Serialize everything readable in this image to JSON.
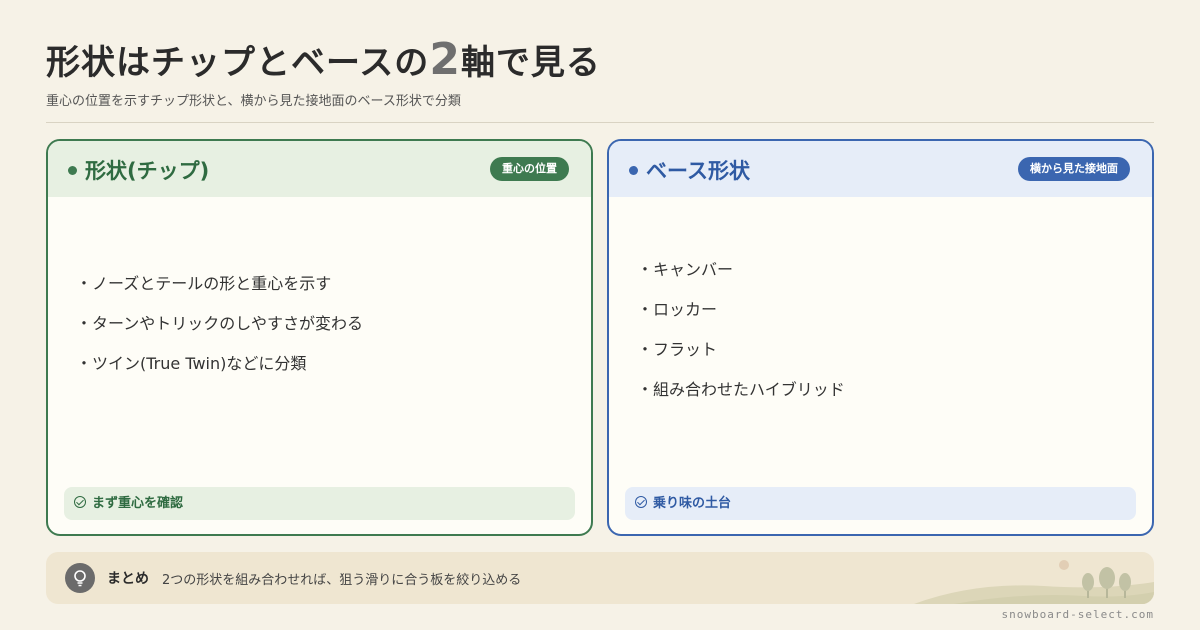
{
  "header": {
    "title_prefix": "形状はチップとベースの",
    "title_number": "2",
    "title_suffix": "軸で見る",
    "subtitle": "重心の位置を示すチップ形状と、横から見た接地面のベース形状で分類"
  },
  "cards": [
    {
      "title": "形状(チップ)",
      "badge": "重心の位置",
      "items": [
        "ノーズとテールの形と重心を示す",
        "ターンやトリックのしやすさが変わる",
        "ツイン(True Twin)などに分類"
      ],
      "footer": "まず重心を確認"
    },
    {
      "title": "ベース形状",
      "badge": "横から見た接地面",
      "items": [
        "キャンバー",
        "ロッカー",
        "フラット",
        "組み合わせたハイブリッド"
      ],
      "footer": "乗り味の土台"
    }
  ],
  "summary": {
    "label": "まとめ",
    "text": "2つの形状を組み合わせれば、狙う滑りに合う板を絞り込める"
  },
  "footer_url": "snowboard-select.com",
  "colors": {
    "background": "#f6f2e7",
    "chip_accent": "#3e7a50",
    "base_accent": "#3b66b0"
  },
  "icons": [
    "dot-icon",
    "check-circle-icon",
    "lightbulb-icon"
  ]
}
